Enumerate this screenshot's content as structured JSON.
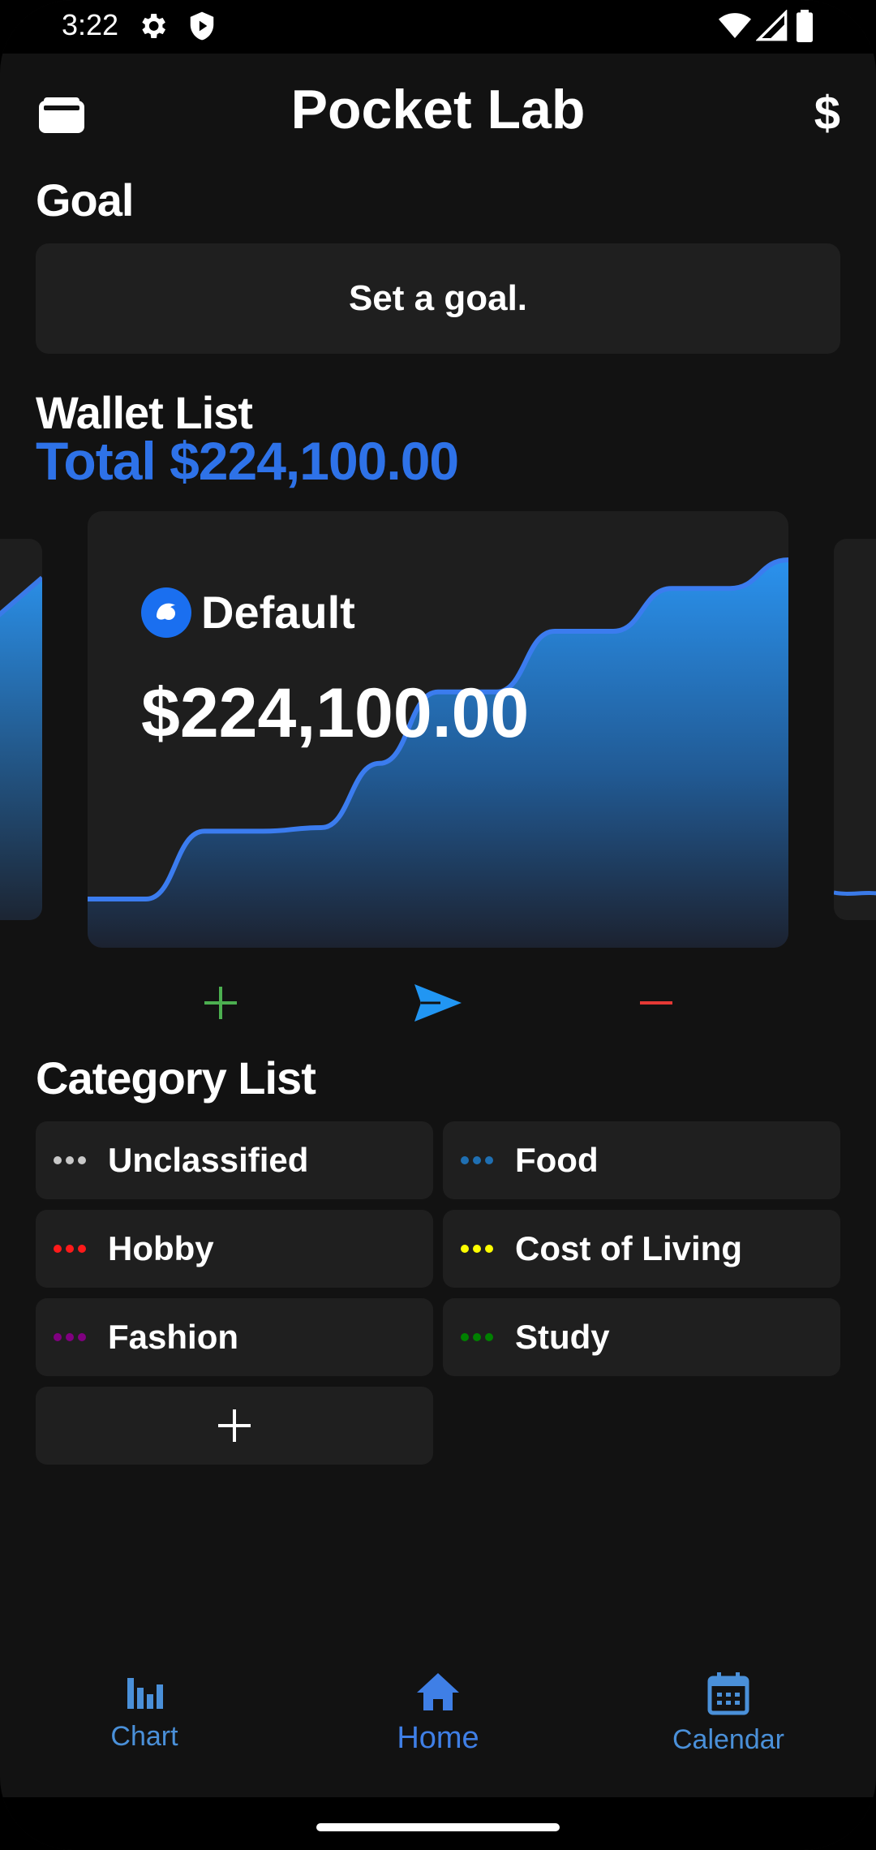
{
  "status_bar": {
    "time": "3:22",
    "left_icons": [
      "settings-icon",
      "shield-icon"
    ],
    "right_icons": [
      "wifi-icon",
      "signal-icon",
      "battery-icon"
    ]
  },
  "header": {
    "title": "Pocket Lab",
    "left_icon": "wallet-icon",
    "right_label": "$"
  },
  "goal": {
    "section_title": "Goal",
    "prompt": "Set a goal."
  },
  "wallets": {
    "section_title": "Wallet List",
    "total": "Total $224,100.00",
    "current": {
      "name": "Default",
      "amount": "$224,100.00",
      "trend": [
        5,
        5,
        24,
        24,
        25,
        43,
        63,
        63,
        80,
        80,
        92,
        92,
        100
      ]
    }
  },
  "actions": {
    "income_icon": "plus-icon",
    "transfer_icon": "send-icon",
    "expense_icon": "minus-icon"
  },
  "categories": {
    "section_title": "Category List",
    "items": [
      {
        "label": "Unclassified",
        "color": "#c8c8c8"
      },
      {
        "label": "Food",
        "color": "#1f6fb2"
      },
      {
        "label": "Hobby",
        "color": "#ff1a1a"
      },
      {
        "label": "Cost of Living",
        "color": "#ffff00"
      },
      {
        "label": "Fashion",
        "color": "#800080"
      },
      {
        "label": "Study",
        "color": "#008000"
      }
    ],
    "add_icon": "plus-icon"
  },
  "nav": {
    "items": [
      {
        "label": "Chart",
        "icon": "bar-chart-icon"
      },
      {
        "label": "Home",
        "icon": "home-icon"
      },
      {
        "label": "Calendar",
        "icon": "calendar-icon"
      }
    ]
  },
  "colors": {
    "accent": "#2e72e8",
    "background": "#121212",
    "card": "#1f1f1f",
    "income": "#4caf50",
    "transfer": "#2196f3",
    "expense": "#e53935"
  }
}
